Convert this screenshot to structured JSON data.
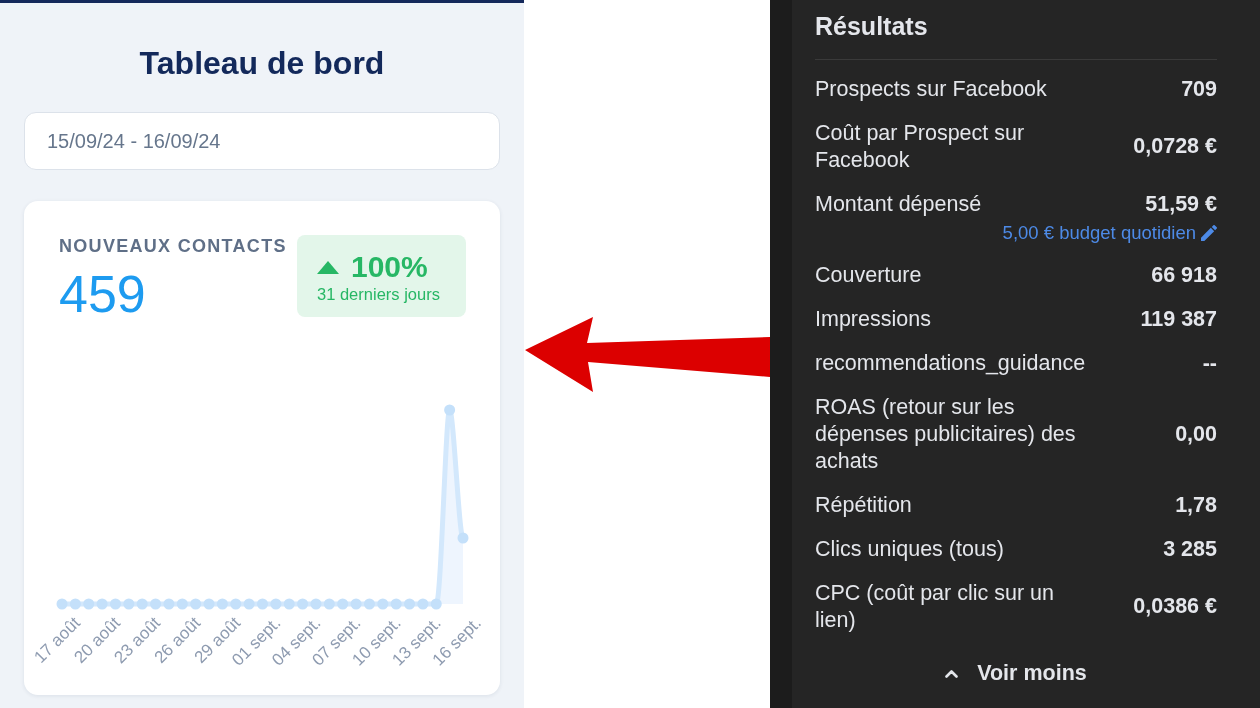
{
  "dashboard": {
    "title": "Tableau de bord",
    "date_range": {
      "value": "15/09/24 - 16/09/24"
    },
    "card": {
      "label": "NOUVEAUX CONTACTS",
      "value": "459",
      "change": {
        "increase": true,
        "percent": "100%",
        "period": "31 derniers jours"
      },
      "chart": {
        "x_labels": [
          "17 août",
          "20 août",
          "23 août",
          "26 août",
          "29 août",
          "01 sept.",
          "04 sept.",
          "07 sept.",
          "10 sept.",
          "13 sept.",
          "16 sept."
        ]
      }
    }
  },
  "results": {
    "title": "Résultats",
    "rows": [
      {
        "label": "Prospects sur Facebook",
        "value": "709"
      },
      {
        "label": "Coût par Prospect sur Facebook",
        "value": "0,0728 €"
      },
      {
        "label": "Montant dépensé",
        "value": "51,59 €",
        "link": "5,00 € budget quotidien"
      },
      {
        "label": "Couverture",
        "value": "66 918"
      },
      {
        "label": "Impressions",
        "value": "119 387"
      },
      {
        "label": "recommendations_guidance",
        "value": "--"
      },
      {
        "label": "ROAS (retour sur les dépenses publicitaires) des achats",
        "value": "0,00"
      },
      {
        "label": "Répétition",
        "value": "1,78"
      },
      {
        "label": "Clics uniques (tous)",
        "value": "3 285"
      },
      {
        "label": "CPC (coût par clic sur un lien)",
        "value": "0,0386 €"
      }
    ],
    "toggle": {
      "label": "Voir moins",
      "expanded": true
    }
  }
}
